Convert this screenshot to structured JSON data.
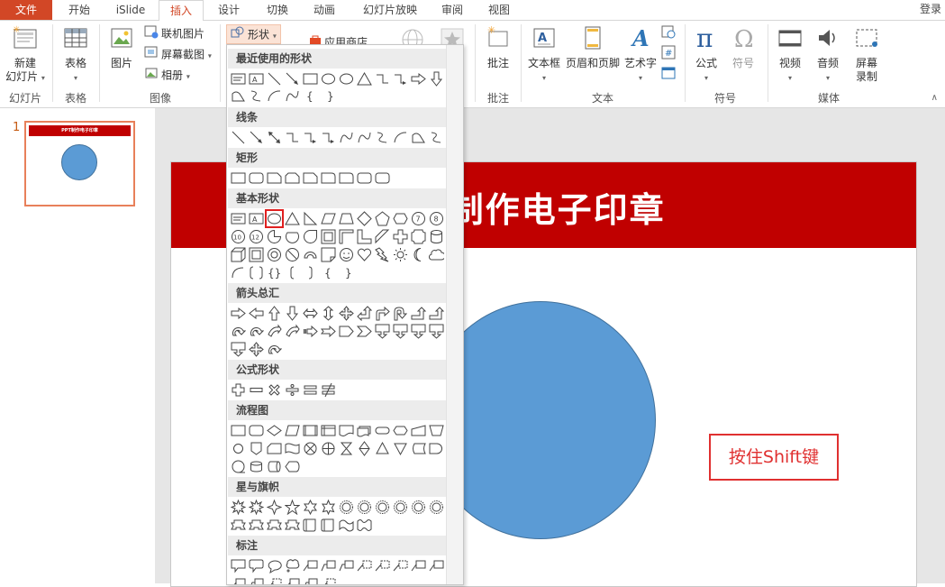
{
  "tabs": [
    "文件",
    "开始",
    "iSlide",
    "插入",
    "设计",
    "切换",
    "动画",
    "幻灯片放映",
    "审阅",
    "视图"
  ],
  "login": "登录",
  "ribbon": {
    "new_slide": "新建\n幻灯片",
    "new_slide_l1": "新建",
    "new_slide_l2": "幻灯片",
    "group_slides": "幻灯片",
    "table": "表格",
    "group_table": "表格",
    "picture": "图片",
    "online_picture": "联机图片",
    "screenshot": "屏幕截图",
    "album": "相册",
    "group_images": "图像",
    "shapes": "形状",
    "app_store": "应用商店",
    "comment": "批注",
    "group_comment": "批注",
    "textbox": "文本框",
    "header_footer": "页眉和页脚",
    "wordart": "艺术字",
    "group_text": "文本",
    "equation": "公式",
    "symbol": "符号",
    "group_symbols": "符号",
    "video": "视频",
    "audio": "音频",
    "screen_record_l1": "屏幕",
    "screen_record_l2": "录制",
    "group_media": "媒体"
  },
  "slides_pane": {
    "slide_number": "1",
    "thumb_title": "PPT制作电子印章"
  },
  "slide": {
    "title_visible": "T制作电子印章",
    "hint": "按住Shift键"
  },
  "shapes_menu": {
    "sections": [
      "最近使用的形状",
      "线条",
      "矩形",
      "基本形状",
      "箭头总汇",
      "公式形状",
      "流程图",
      "星与旗帜",
      "标注"
    ]
  },
  "colors": {
    "file_tab": "#d24726",
    "title_band": "#c00000",
    "circle": "#5b9bd5",
    "accent_red": "#e03030"
  }
}
